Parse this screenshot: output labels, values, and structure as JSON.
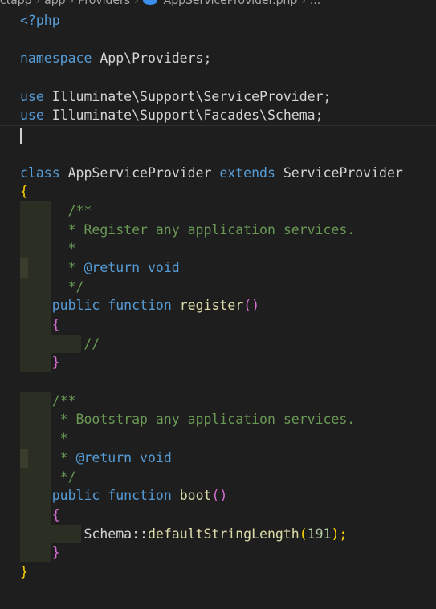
{
  "breadcrumb": {
    "items": [
      "ctapp",
      "app",
      "Providers"
    ],
    "file": "AppServiceProvider.php",
    "ellipsis": "..."
  },
  "code": {
    "php_open": "<?php",
    "namespace_kw": "namespace",
    "namespace_name": "App\\Providers;",
    "use_kw": "use",
    "use1": "Illuminate\\Support\\ServiceProvider;",
    "use2": "Illuminate\\Support\\Facades\\Schema;",
    "class_kw": "class",
    "class_name": "AppServiceProvider",
    "extends_kw": "extends",
    "parent_class": "ServiceProvider",
    "brace_open": "{",
    "brace_close": "}",
    "doc_open": "/**",
    "doc_register": " * Register any application services.",
    "doc_star": " *",
    "doc_return_prefix": " * ",
    "doc_return_tag": "@return",
    "doc_return_type": " void",
    "doc_close": " */",
    "public_kw": "public",
    "function_kw": "function",
    "register_fn": "register",
    "parens": "()",
    "comment_slashes": "//",
    "doc_boot": " * Bootstrap any application services.",
    "boot_fn": "boot",
    "schema_call": "Schema::",
    "default_fn": "defaultStringLength",
    "paren_open": "(",
    "arg_num": "191",
    "paren_close_semi": ");"
  },
  "colors": {
    "background": "#1e1e1e",
    "keyword": "#569cd6",
    "comment": "#6a9955",
    "function": "#dcdcaa",
    "bracket_level1": "#ffd700",
    "bracket_level2": "#da70d6",
    "number": "#b5cea8"
  }
}
